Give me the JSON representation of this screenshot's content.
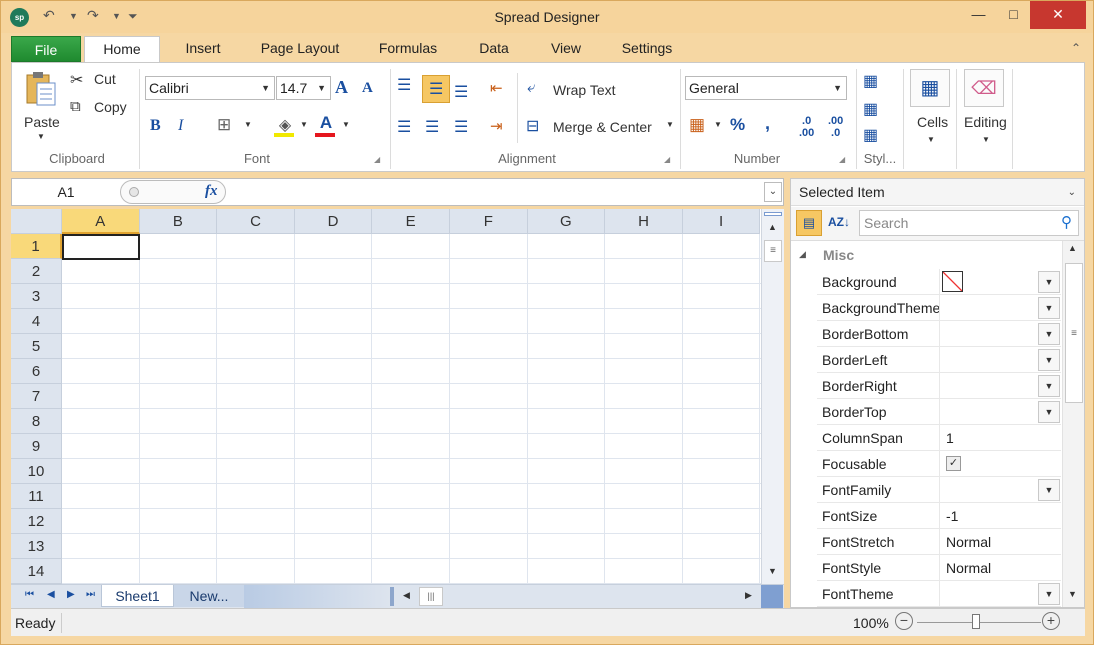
{
  "window": {
    "title": "Spread Designer",
    "logo_text": "sp",
    "controls": {
      "minimize": "—",
      "maximize": "□",
      "close": "✕"
    }
  },
  "ribbon_tabs": {
    "file": "File",
    "items": [
      "Home",
      "Insert",
      "Page Layout",
      "Formulas",
      "Data",
      "View",
      "Settings"
    ],
    "active": "Home"
  },
  "clipboard": {
    "paste": "Paste",
    "cut": "Cut",
    "copy": "Copy",
    "label": "Clipboard"
  },
  "font": {
    "family": "Calibri",
    "size": "14.7",
    "label": "Font"
  },
  "alignment": {
    "wrap_text": "Wrap Text",
    "merge_center": "Merge &  Center",
    "label": "Alignment"
  },
  "number": {
    "format": "General",
    "percent": "%",
    "comma": ",",
    "label": "Number"
  },
  "styles": {
    "label": "Styl..."
  },
  "cells": {
    "label": "Cells"
  },
  "editing": {
    "label": "Editing"
  },
  "formula_bar": {
    "name_box": "A1",
    "fx": "fx",
    "value": ""
  },
  "grid": {
    "columns": [
      "A",
      "B",
      "C",
      "D",
      "E",
      "F",
      "G",
      "H",
      "I"
    ],
    "rows": [
      "1",
      "2",
      "3",
      "4",
      "5",
      "6",
      "7",
      "8",
      "9",
      "10",
      "11",
      "12",
      "13",
      "14"
    ],
    "selected_cell": "A1"
  },
  "sheets": {
    "tabs": [
      "Sheet1",
      "New..."
    ],
    "active": "Sheet1"
  },
  "property_panel": {
    "header": "Selected Item",
    "search_placeholder": "Search",
    "category": "Misc",
    "rows": [
      {
        "name": "Background",
        "value": "",
        "dropdown": true,
        "swatch": true
      },
      {
        "name": "BackgroundTheme",
        "value": "",
        "dropdown": true
      },
      {
        "name": "BorderBottom",
        "value": "",
        "dropdown": true
      },
      {
        "name": "BorderLeft",
        "value": "",
        "dropdown": true
      },
      {
        "name": "BorderRight",
        "value": "",
        "dropdown": true
      },
      {
        "name": "BorderTop",
        "value": "",
        "dropdown": true
      },
      {
        "name": "ColumnSpan",
        "value": "1",
        "dropdown": false
      },
      {
        "name": "Focusable",
        "value": "",
        "dropdown": false,
        "checkbox": true
      },
      {
        "name": "FontFamily",
        "value": "",
        "dropdown": true
      },
      {
        "name": "FontSize",
        "value": "-1",
        "dropdown": false
      },
      {
        "name": "FontStretch",
        "value": "Normal",
        "dropdown": false
      },
      {
        "name": "FontStyle",
        "value": "Normal",
        "dropdown": false
      },
      {
        "name": "FontTheme",
        "value": "",
        "dropdown": true
      }
    ]
  },
  "status": {
    "text": "Ready",
    "zoom": "100%"
  },
  "colors": {
    "accent": "#f6c763",
    "file_tab": "#2a9a3b",
    "close": "#c7372f",
    "title_bg": "#f6d49c"
  }
}
